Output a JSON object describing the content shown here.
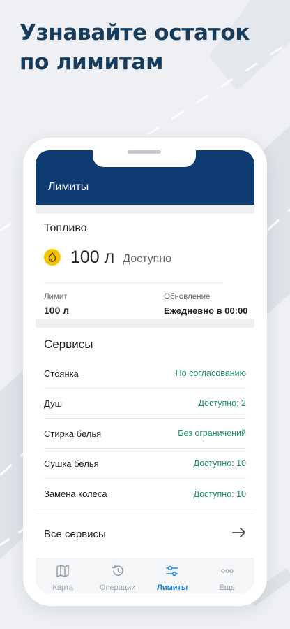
{
  "promo": {
    "headline": "Узнавайте остаток по лимитам"
  },
  "header": {
    "title": "Лимиты"
  },
  "fuel": {
    "title": "Топливо",
    "amount": "100 л",
    "status": "Доступно",
    "limit_label": "Лимит",
    "limit_value": "100 л",
    "update_label": "Обновление",
    "update_value": "Ежедневно в 00:00"
  },
  "services": {
    "title": "Сервисы",
    "items": [
      {
        "name": "Стоянка",
        "status": "По согласованию"
      },
      {
        "name": "Душ",
        "status": "Доступно: 2"
      },
      {
        "name": "Стирка белья",
        "status": "Без ограничений"
      },
      {
        "name": "Сушка белья",
        "status": "Доступно: 10"
      },
      {
        "name": "Замена колеса",
        "status": "Доступно: 10"
      }
    ],
    "all_label": "Все сервисы"
  },
  "tabs": [
    {
      "label": "Карта",
      "icon": "map-icon",
      "active": false
    },
    {
      "label": "Операции",
      "icon": "history-icon",
      "active": false
    },
    {
      "label": "Лимиты",
      "icon": "sliders-icon",
      "active": true
    },
    {
      "label": "Еще",
      "icon": "more-icon",
      "active": false
    }
  ],
  "colors": {
    "primary": "#0d3b72",
    "accent": "#1f86d8",
    "success": "#1a9164",
    "fuel_icon": "#f3c300",
    "headline": "#173c5c"
  }
}
